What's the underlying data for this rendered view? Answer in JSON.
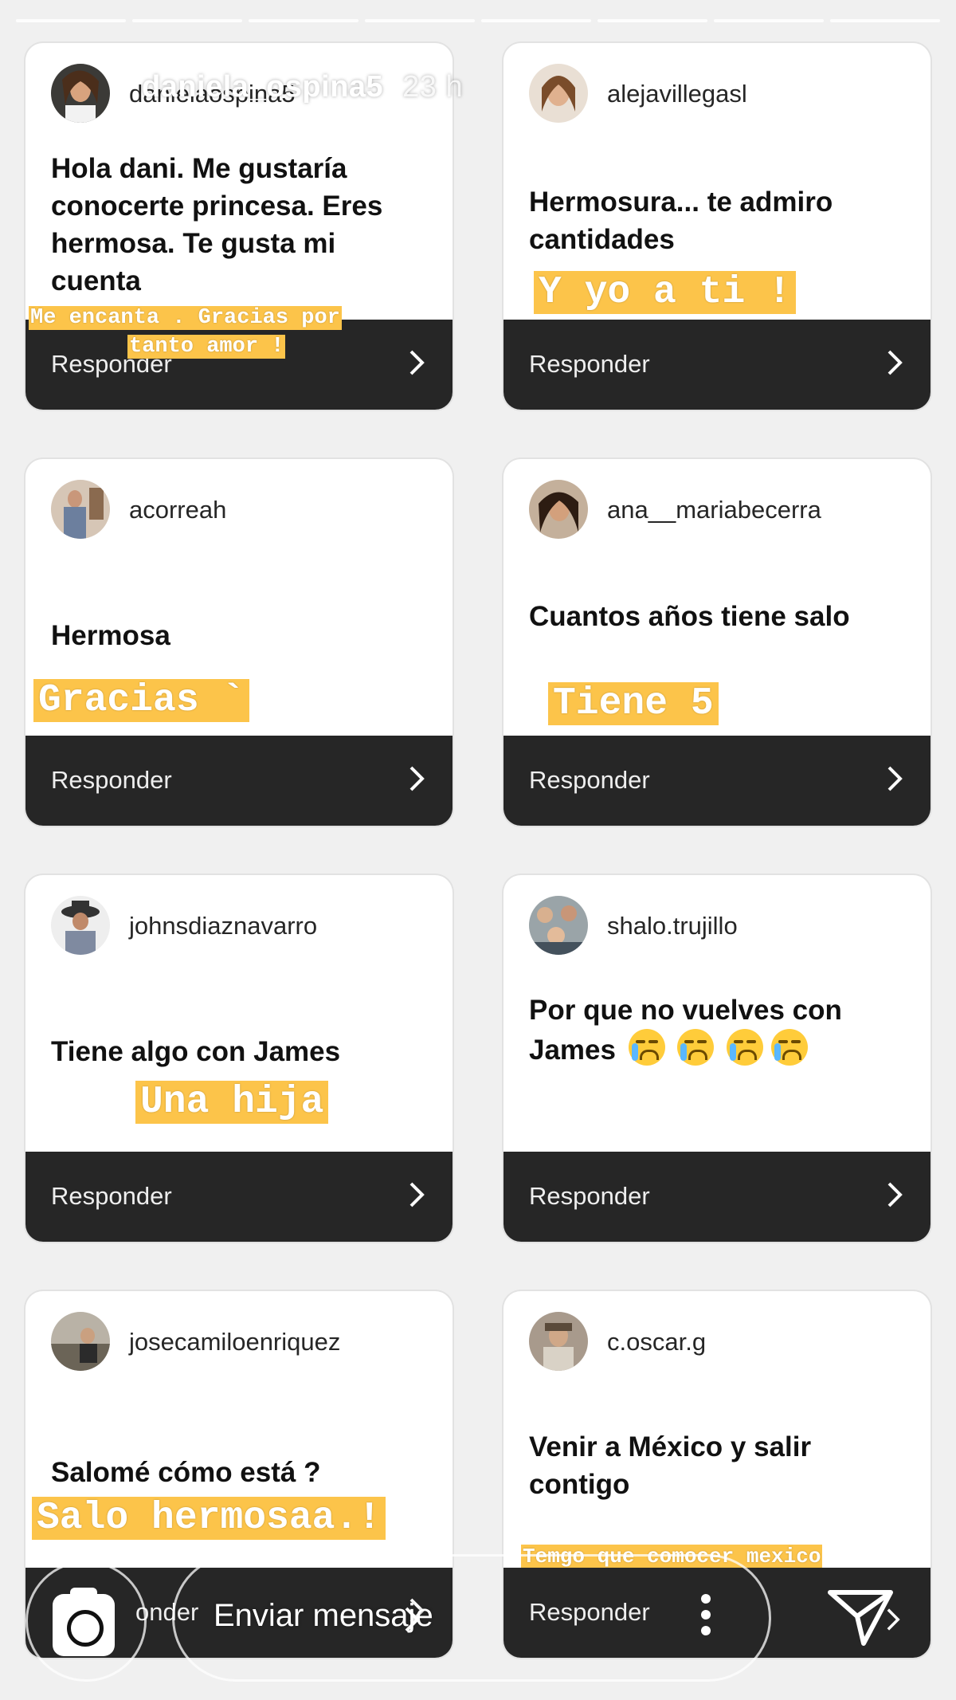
{
  "story": {
    "username": "daniela_ospina5",
    "time": "23 h",
    "progress_segments": 8
  },
  "cards": [
    {
      "username": "danielaospina5",
      "question": "Hola dani. Me gustaría conocerte princesa. Eres hermosa. Te gusta mi cuenta",
      "answer": "Me encanta . Gracias por tanto amor !",
      "answer_line1": "Me encanta . Gracias por",
      "answer_line2": "tanto amor !",
      "reply_label": "Responder"
    },
    {
      "username": "alejavillegasl",
      "question": "Hermosura... te admiro cantidades",
      "answer": "Y yo a ti !",
      "reply_label": "Responder"
    },
    {
      "username": "acorreah",
      "question": "Hermosa",
      "answer": "Gracias `",
      "reply_label": "Responder"
    },
    {
      "username": "ana__mariabecerra",
      "question": "Cuantos años tiene salo",
      "answer": "Tiene 5",
      "reply_label": "Responder"
    },
    {
      "username": "johnsdiaznavarro",
      "question": "Tiene algo con James",
      "answer": "Una hija",
      "reply_label": "Responder"
    },
    {
      "username": "shalo.trujillo",
      "question": "Por que no vuelves con James",
      "reply_label": "Responder"
    },
    {
      "username": "josecamiloenriquez",
      "question": "Salomé cómo está ?",
      "answer": "Salo hermosaa.!",
      "reply_label": "Responder",
      "reply_label_visible": "onder"
    },
    {
      "username": "c.oscar.g",
      "question": "Venir a México y salir contigo",
      "answer": "Temgo que comocer mexico",
      "reply_label": "Responder"
    }
  ],
  "composer": {
    "placeholder": "Enviar mensaje"
  },
  "colors": {
    "answer_highlight": "#fcc44a",
    "card_footer": "#262626",
    "background": "#f0f0f0"
  },
  "icons": [
    "camera-icon",
    "more-icon",
    "send-icon",
    "chevron-right-icon",
    "crying-emoji"
  ]
}
